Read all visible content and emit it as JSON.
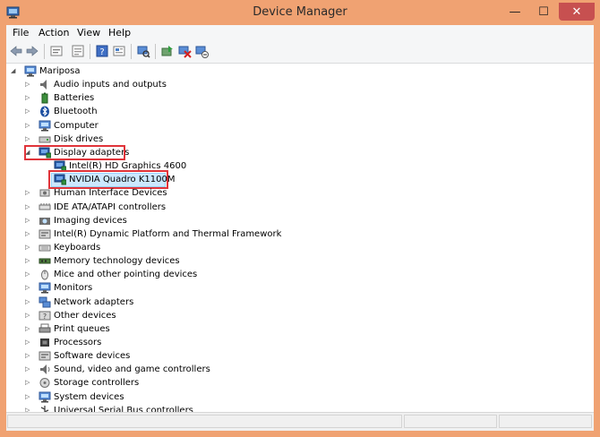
{
  "window": {
    "title": "Device Manager",
    "min_glyph": "—",
    "max_glyph": "☐",
    "close_glyph": "✕"
  },
  "menu": {
    "items": [
      "File",
      "Action",
      "View",
      "Help"
    ]
  },
  "toolbar": {
    "buttons": [
      "back-icon",
      "forward-icon",
      "up-icon",
      "properties-icon",
      "help-icon",
      "show-hidden-icon",
      "scan-hardware-icon",
      "update-driver-icon",
      "disable-device-icon",
      "uninstall-device-icon"
    ]
  },
  "tree": {
    "root": "Mariposa",
    "categories": [
      "Audio inputs and outputs",
      "Batteries",
      "Bluetooth",
      "Computer",
      "Disk drives",
      "Display adapters",
      "Human Interface Devices",
      "IDE ATA/ATAPI controllers",
      "Imaging devices",
      "Intel(R) Dynamic Platform and Thermal Framework",
      "Keyboards",
      "Memory technology devices",
      "Mice and other pointing devices",
      "Monitors",
      "Network adapters",
      "Other devices",
      "Print queues",
      "Processors",
      "Software devices",
      "Sound, video and game controllers",
      "Storage controllers",
      "System devices",
      "Universal Serial Bus controllers"
    ],
    "display_children": [
      "Intel(R) HD Graphics 4600",
      "NVIDIA Quadro K1100M"
    ],
    "expanded_glyph": "◢",
    "collapsed_glyph": "▷"
  },
  "colors": {
    "frame": "#F0A272",
    "highlight_red": "#E0343A",
    "selection": "#CCE8FF"
  }
}
